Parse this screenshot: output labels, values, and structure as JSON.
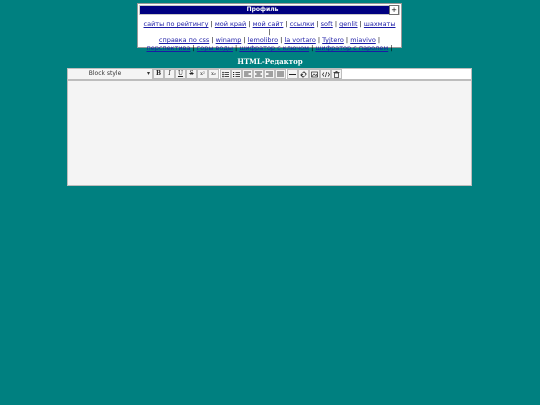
{
  "profile": {
    "title": "Профиль",
    "toggle": "+",
    "links": [
      "сайты по рейтингу",
      "мой край",
      "мой сайт",
      "ссылки",
      "soft",
      "genlit",
      "шахматы",
      "справка по css",
      "winamp",
      "lemolibro",
      "la vortaro",
      "Tyjtero",
      "miavivo",
      "перспектива",
      "горы воды",
      "шифратор с ключом",
      "шифратор с паролем"
    ],
    "separator": "|"
  },
  "editor": {
    "title": "HTML-Редактор",
    "block_style": "Block style",
    "buttons": [
      {
        "name": "bold-button",
        "glyph": "B"
      },
      {
        "name": "italic-button",
        "glyph": "I"
      },
      {
        "name": "underline-button",
        "glyph": "U"
      },
      {
        "name": "strikethrough-button",
        "glyph": "S"
      },
      {
        "name": "superscript-button",
        "glyph": "x²"
      },
      {
        "name": "subscript-button",
        "glyph": "x₂"
      }
    ]
  }
}
